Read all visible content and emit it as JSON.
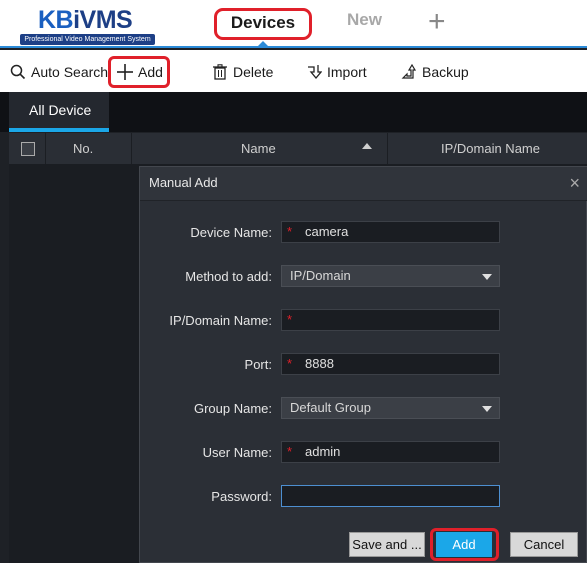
{
  "app": {
    "logo_text_kb": "KB",
    "logo_text_rest": "iVMS",
    "logo_subtitle": "Professional Video Management System"
  },
  "tabs": {
    "devices": "Devices",
    "new": "New",
    "plus": "+"
  },
  "toolbar": {
    "auto_search": "Auto Search",
    "add": "Add",
    "delete": "Delete",
    "import": "Import",
    "backup": "Backup"
  },
  "device_tabs": {
    "all_device": "All Device"
  },
  "table": {
    "columns": [
      "No.",
      "Name",
      "IP/Domain Name"
    ]
  },
  "dialog": {
    "title": "Manual Add",
    "close": "×",
    "fields": {
      "device_name_label": "Device Name:",
      "device_name_value": "camera",
      "method_label": "Method to add:",
      "method_value": "IP/Domain",
      "ip_label": "IP/Domain Name:",
      "ip_value": "",
      "port_label": "Port:",
      "port_value": "8888",
      "group_label": "Group Name:",
      "group_value": "Default Group",
      "user_label": "User Name:",
      "user_value": "admin",
      "password_label": "Password:",
      "password_value": ""
    },
    "required_mark": "*",
    "buttons": {
      "save_and": "Save and ...",
      "add": "Add",
      "cancel": "Cancel"
    }
  },
  "colors": {
    "accent": "#1ba7e8",
    "highlight": "#e0202a",
    "brand": "#1d3f86"
  }
}
